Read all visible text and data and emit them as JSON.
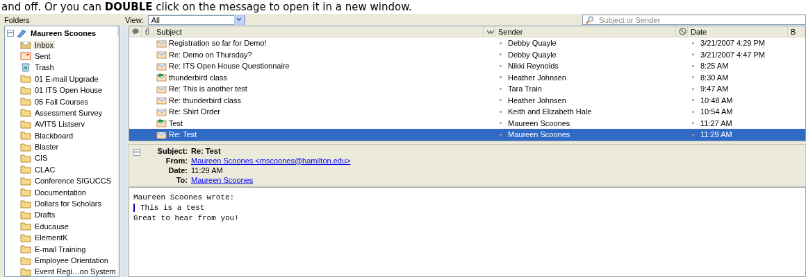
{
  "caption": "and off. Or you can **DOUBLE** click on the message to open it in a new window.",
  "toolbar": {
    "folders_label": "Folders",
    "view_label": "View:",
    "view_value": "All",
    "search": {
      "placeholder": "Subject or Sender"
    }
  },
  "folder_tree": {
    "account": {
      "name": "Maureen Scoones",
      "expanded": true,
      "children": [
        {
          "name": "Inbox",
          "kind": "inbox",
          "selected": true
        },
        {
          "name": "Sent",
          "kind": "sent",
          "selected": false
        },
        {
          "name": "Trash",
          "kind": "trash",
          "selected": false
        },
        {
          "name": "01 E-mail Upgrade",
          "kind": "folder",
          "selected": false
        },
        {
          "name": "01 ITS Open House",
          "kind": "folder",
          "selected": false
        },
        {
          "name": "05 Fall Courses",
          "kind": "folder",
          "selected": false
        },
        {
          "name": "Assessment Survey",
          "kind": "folder",
          "selected": false
        },
        {
          "name": "AVITS Listserv",
          "kind": "folder",
          "selected": false
        },
        {
          "name": "Blackboard",
          "kind": "folder",
          "selected": false
        },
        {
          "name": "Blaster",
          "kind": "folder",
          "selected": false
        },
        {
          "name": "CIS",
          "kind": "folder",
          "selected": false
        },
        {
          "name": "CLAC",
          "kind": "folder",
          "selected": false
        },
        {
          "name": "Conference SIGUCCS",
          "kind": "folder",
          "selected": false
        },
        {
          "name": "Documentation",
          "kind": "folder",
          "selected": false
        },
        {
          "name": "Dollars for Scholars",
          "kind": "folder",
          "selected": false
        },
        {
          "name": "Drafts",
          "kind": "folder",
          "selected": false
        },
        {
          "name": "Educause",
          "kind": "folder",
          "selected": false
        },
        {
          "name": "ElementK",
          "kind": "folder",
          "selected": false
        },
        {
          "name": "E-mail Training",
          "kind": "folder",
          "selected": false
        },
        {
          "name": "Employee Orientation",
          "kind": "folder",
          "selected": false
        },
        {
          "name": "Event Regi…on System",
          "kind": "folder",
          "selected": false
        }
      ]
    }
  },
  "message_list": {
    "columns": [
      {
        "kind": "thread"
      },
      {
        "kind": "attachment"
      },
      {
        "kind": "text",
        "label": "Subject"
      },
      {
        "kind": "junk"
      },
      {
        "kind": "text",
        "label": "Sender"
      },
      {
        "kind": "status"
      },
      {
        "kind": "text",
        "label": "Date"
      },
      {
        "kind": "text",
        "label": "B"
      }
    ],
    "rows": [
      {
        "subject": "Registration so far for Demo!",
        "sender": "Debby Quayle",
        "date": "3/21/2007 4:29 PM",
        "kind": "read",
        "selected": false
      },
      {
        "subject": "Re: Demo on Thursday?",
        "sender": "Debby Quayle",
        "date": "3/21/2007 4:47 PM",
        "kind": "read",
        "selected": false
      },
      {
        "subject": "Re: ITS Open House Questionnaire",
        "sender": "Nikki Reynolds",
        "date": "8:25 AM",
        "kind": "read",
        "selected": false
      },
      {
        "subject": "thunderbird class",
        "sender": "Heather Johnsen",
        "date": "8:30 AM",
        "kind": "replied",
        "selected": false
      },
      {
        "subject": "Re: This is another test",
        "sender": "Tara Train",
        "date": "9:47 AM",
        "kind": "read",
        "selected": false
      },
      {
        "subject": "Re: thunderbird class",
        "sender": "Heather Johnsen",
        "date": "10:48 AM",
        "kind": "read",
        "selected": false
      },
      {
        "subject": "Re: Shirt Order",
        "sender": "Keith and Elizabeth Hale",
        "date": "10:54 AM",
        "kind": "read",
        "selected": false
      },
      {
        "subject": "Test",
        "sender": "Maureen Scoones",
        "date": "11:27 AM",
        "kind": "replied",
        "selected": false
      },
      {
        "subject": "Re: Test",
        "sender": "Maureen Scoones",
        "date": "11:29 AM",
        "kind": "read",
        "selected": true
      }
    ]
  },
  "message_header": {
    "expanded": true,
    "fields": [
      {
        "label": "Subject:",
        "value": "Re: Test",
        "kind": "bold"
      },
      {
        "label": "From:",
        "value": "Maureen Scoones <mscoones@hamilton.edu>",
        "kind": "link"
      },
      {
        "label": "Date:",
        "value": "11:29 AM",
        "kind": "plain"
      },
      {
        "label": "To:",
        "value": "Maureen Scoones",
        "kind": "link"
      }
    ]
  },
  "message_body": [
    {
      "kind": "line",
      "text": "Maureen Scoones wrote:"
    },
    {
      "kind": "quote",
      "text": "This is a test"
    },
    {
      "kind": "line",
      "text": "Great to hear from you!"
    }
  ]
}
